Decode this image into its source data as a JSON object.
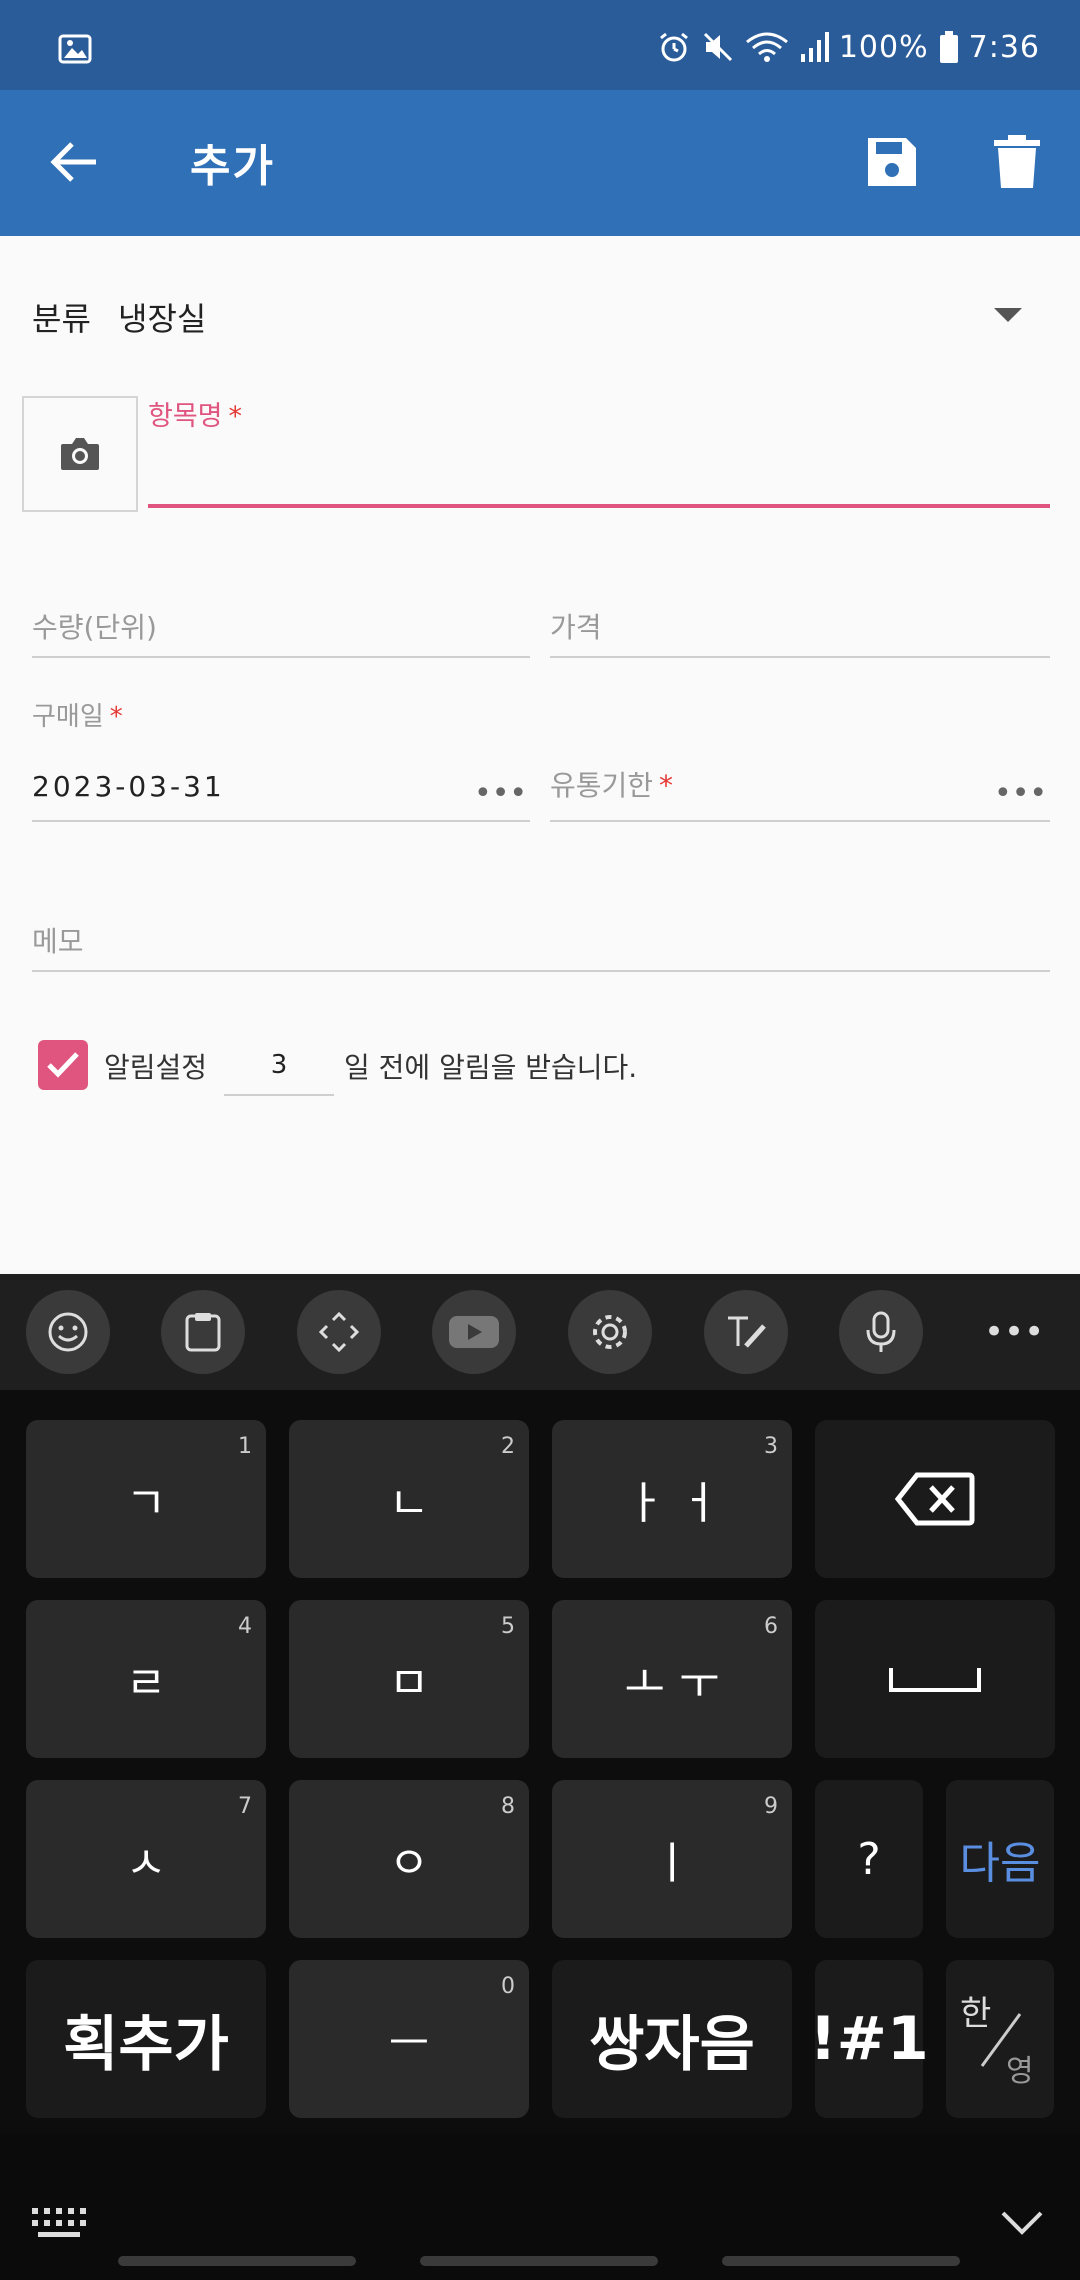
{
  "status_bar": {
    "battery": "100%",
    "time": "7:36"
  },
  "app_bar": {
    "title": "추가"
  },
  "form": {
    "category_label": "분류",
    "category_value": "냉장실",
    "item_name_label": "항목명",
    "required_mark": "*",
    "quantity_placeholder": "수량(단위)",
    "price_placeholder": "가격",
    "purchase_label": "구매일",
    "purchase_value": "2023-03-31",
    "expiry_label": "유통기한",
    "more_dots": "•••",
    "memo_placeholder": "메모",
    "alarm_checked": true,
    "alarm_label": "알림설정",
    "alarm_days": "3",
    "alarm_suffix": "일 전에 알림을 받습니다."
  },
  "keyboard": {
    "toolbar_more": "•••",
    "rows": [
      [
        {
          "label": "ㄱ",
          "num": "1"
        },
        {
          "label": "ㄴ",
          "num": "2"
        },
        {
          "label": "ㅏ ㅓ",
          "num": "3"
        }
      ],
      [
        {
          "label": "ㄹ",
          "num": "4"
        },
        {
          "label": "ㅁ",
          "num": "5"
        },
        {
          "label": "ㅗ ㅜ",
          "num": "6"
        }
      ],
      [
        {
          "label": "ㅅ",
          "num": "7"
        },
        {
          "label": "ㅇ",
          "num": "8"
        },
        {
          "label": "ㅣ",
          "num": "9"
        }
      ],
      [
        {
          "label": "획추가",
          "num": ""
        },
        {
          "label": "ㅡ",
          "num": "0"
        },
        {
          "label": "쌍자음",
          "num": ""
        }
      ]
    ],
    "question": "?",
    "next": "다음",
    "symbols": "!#1",
    "lang_top": "한",
    "lang_bottom": "영"
  },
  "colors": {
    "status_bar": "#2b5c9a",
    "app_bar": "#3070b6",
    "accent": "#e0557f",
    "next_key": "#5a8ee0"
  }
}
